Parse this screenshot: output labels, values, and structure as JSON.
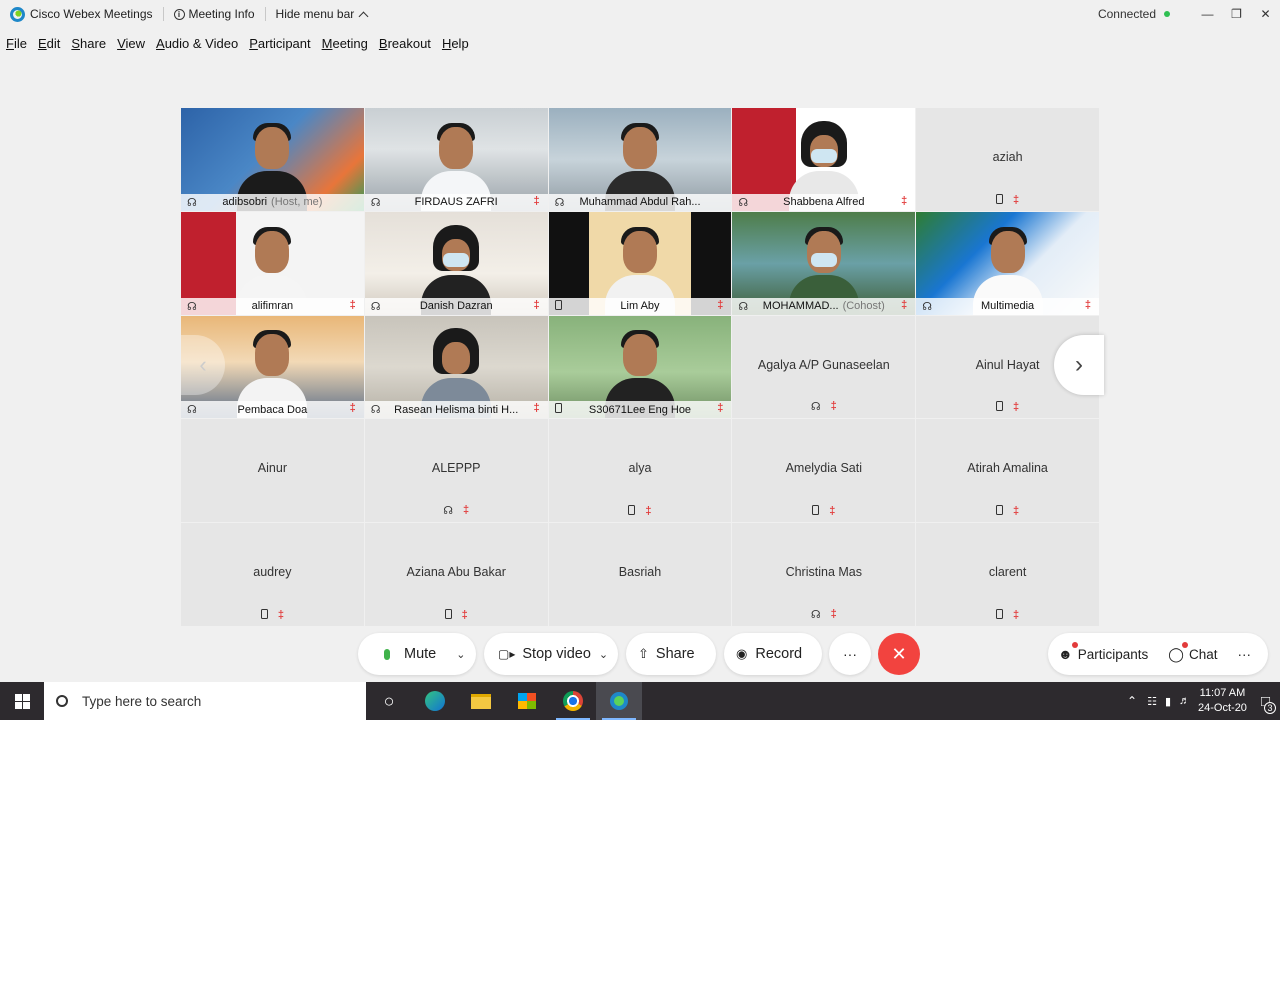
{
  "titlebar": {
    "app_title": "Cisco Webex Meetings",
    "meeting_info": "Meeting Info",
    "hide_menu": "Hide menu bar",
    "status": "Connected"
  },
  "menu": [
    "File",
    "Edit",
    "Share",
    "View",
    "Audio & Video",
    "Participant",
    "Meeting",
    "Breakout",
    "Help"
  ],
  "tiles": [
    {
      "name": "adibsobri",
      "role": "(Host, me)",
      "icon": "headset",
      "muted": false,
      "video": true
    },
    {
      "name": "FIRDAUS ZAFRI",
      "role": "",
      "icon": "headset",
      "muted": true,
      "video": true
    },
    {
      "name": "Muhammad Abdul Rah...",
      "role": "",
      "icon": "headset-speaking",
      "muted": false,
      "video": true
    },
    {
      "name": "Shabbena Alfred",
      "role": "",
      "icon": "headset",
      "muted": true,
      "video": true
    },
    {
      "name": "aziah",
      "role": "",
      "icon": "phone",
      "muted": true,
      "video": false
    },
    {
      "name": "alifimran",
      "role": "",
      "icon": "headset",
      "muted": true,
      "video": true
    },
    {
      "name": "Danish Dazran",
      "role": "",
      "icon": "headset",
      "muted": true,
      "video": true
    },
    {
      "name": "Lim Aby",
      "role": "",
      "icon": "phone",
      "muted": true,
      "video": true
    },
    {
      "name": "MOHAMMAD...",
      "role": "(Cohost)",
      "icon": "headset",
      "muted": true,
      "video": true
    },
    {
      "name": "Multimedia",
      "role": "",
      "icon": "headset",
      "muted": true,
      "video": true
    },
    {
      "name": "Pembaca Doa",
      "role": "",
      "icon": "headset",
      "muted": true,
      "video": true
    },
    {
      "name": "Rasean Helisma binti H...",
      "role": "",
      "icon": "headset",
      "muted": true,
      "video": true
    },
    {
      "name": "S30671Lee Eng Hoe",
      "role": "",
      "icon": "phone",
      "muted": true,
      "video": true
    },
    {
      "name": "Agalya A/P Gunaseelan",
      "role": "",
      "icon": "headset",
      "muted": true,
      "video": false
    },
    {
      "name": "Ainul Hayat",
      "role": "",
      "icon": "phone",
      "muted": true,
      "video": false
    },
    {
      "name": "Ainur",
      "role": "",
      "icon": "none",
      "muted": false,
      "video": false
    },
    {
      "name": "ALEPPP",
      "role": "",
      "icon": "headset",
      "muted": true,
      "video": false
    },
    {
      "name": "alya",
      "role": "",
      "icon": "phone",
      "muted": true,
      "video": false
    },
    {
      "name": "Amelydia Sati",
      "role": "",
      "icon": "phone",
      "muted": true,
      "video": false
    },
    {
      "name": "Atirah Amalina",
      "role": "",
      "icon": "phone",
      "muted": true,
      "video": false
    },
    {
      "name": "audrey",
      "role": "",
      "icon": "phone",
      "muted": true,
      "video": false
    },
    {
      "name": "Aziana Abu Bakar",
      "role": "",
      "icon": "phone",
      "muted": true,
      "video": false
    },
    {
      "name": "Basriah",
      "role": "",
      "icon": "none",
      "muted": false,
      "video": false
    },
    {
      "name": "Christina Mas",
      "role": "",
      "icon": "headset",
      "muted": true,
      "video": false
    },
    {
      "name": "clarent",
      "role": "",
      "icon": "phone",
      "muted": true,
      "video": false
    }
  ],
  "controls": {
    "mute": "Mute",
    "stop_video": "Stop video",
    "share": "Share",
    "record": "Record",
    "more": "···",
    "participants": "Participants",
    "chat": "Chat"
  },
  "taskbar": {
    "search_placeholder": "Type here to search",
    "time": "11:07 AM",
    "date": "24-Oct-20",
    "notifications": "3"
  },
  "colors": {
    "active_border": "#13a9e6",
    "end_button": "#f2433f",
    "muted": "#e23b3b",
    "connected": "#2fbf52"
  }
}
